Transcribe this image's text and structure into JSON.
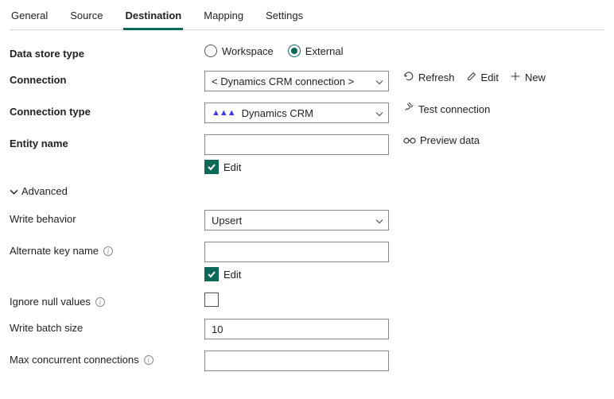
{
  "tabs": {
    "items": [
      {
        "label": "General"
      },
      {
        "label": "Source"
      },
      {
        "label": "Destination",
        "active": true
      },
      {
        "label": "Mapping"
      },
      {
        "label": "Settings"
      }
    ]
  },
  "fields": {
    "dataStoreType": {
      "label": "Data store type",
      "options": {
        "workspace": "Workspace",
        "external": "External"
      },
      "selected": "external"
    },
    "connection": {
      "label": "Connection",
      "value": "< Dynamics CRM connection >",
      "actions": {
        "refresh": "Refresh",
        "edit": "Edit",
        "new": "New"
      }
    },
    "connectionType": {
      "label": "Connection type",
      "value": "Dynamics CRM",
      "actions": {
        "test": "Test connection"
      }
    },
    "entityName": {
      "label": "Entity name",
      "value": "",
      "actions": {
        "preview": "Preview data"
      },
      "editToggle": {
        "label": "Edit",
        "checked": true
      }
    },
    "advanced": {
      "label": "Advanced"
    },
    "writeBehavior": {
      "label": "Write behavior",
      "value": "Upsert"
    },
    "alternateKeyName": {
      "label": "Alternate key name",
      "value": "",
      "editToggle": {
        "label": "Edit",
        "checked": true
      }
    },
    "ignoreNullValues": {
      "label": "Ignore null values",
      "checked": false
    },
    "writeBatchSize": {
      "label": "Write batch size",
      "value": "10"
    },
    "maxConcurrentConnections": {
      "label": "Max concurrent connections",
      "value": ""
    }
  }
}
